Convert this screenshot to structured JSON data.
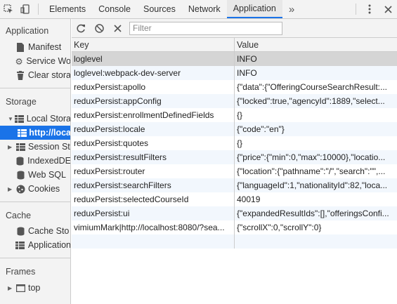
{
  "tabs": [
    {
      "label": "Elements"
    },
    {
      "label": "Console"
    },
    {
      "label": "Sources"
    },
    {
      "label": "Network"
    },
    {
      "label": "Application"
    }
  ],
  "tabs_more": "»",
  "sidebar": {
    "application_title": "Application",
    "application_items": [
      {
        "label": "Manifest"
      },
      {
        "label": "Service Wo"
      },
      {
        "label": "Clear stora"
      }
    ],
    "storage_title": "Storage",
    "local_storage": "Local Stora",
    "local_storage_origin": "http://loca",
    "session_storage": "Session St",
    "indexeddb": "IndexedDE",
    "websql": "Web SQL",
    "cookies": "Cookies",
    "cache_title": "Cache",
    "cache_storage": "Cache Sto",
    "app_cache": "Application",
    "frames_title": "Frames",
    "top_frame": "top"
  },
  "filter": {
    "placeholder": "Filter"
  },
  "table": {
    "key_header": "Key",
    "value_header": "Value",
    "rows": [
      {
        "key": "loglevel",
        "value": "INFO"
      },
      {
        "key": "loglevel:webpack-dev-server",
        "value": "INFO"
      },
      {
        "key": "reduxPersist:apollo",
        "value": "{\"data\":{\"OfferingCourseSearchResult:..."
      },
      {
        "key": "reduxPersist:appConfig",
        "value": "{\"locked\":true,\"agencyId\":1889,\"select..."
      },
      {
        "key": "reduxPersist:enrollmentDefinedFields",
        "value": "{}"
      },
      {
        "key": "reduxPersist:locale",
        "value": "{\"code\":\"en\"}"
      },
      {
        "key": "reduxPersist:quotes",
        "value": "{}"
      },
      {
        "key": "reduxPersist:resultFilters",
        "value": "{\"price\":{\"min\":0,\"max\":10000},\"locatio..."
      },
      {
        "key": "reduxPersist:router",
        "value": "{\"location\":{\"pathname\":\"/\",\"search\":\"\",..."
      },
      {
        "key": "reduxPersist:searchFilters",
        "value": "{\"languageId\":1,\"nationalityId\":82,\"loca..."
      },
      {
        "key": "reduxPersist:selectedCourseId",
        "value": "40019"
      },
      {
        "key": "reduxPersist:ui",
        "value": "{\"expandedResultIds\":[],\"offeringsConfi..."
      },
      {
        "key": "vimiumMark|http://localhost:8080/?sea...",
        "value": "{\"scrollX\":0,\"scrollY\":0}"
      },
      {
        "key": "",
        "value": ""
      }
    ]
  },
  "colors": {
    "accent": "#1a73e8",
    "selected_row": "#d5d5d5",
    "alt_row": "#f2f7fd"
  }
}
